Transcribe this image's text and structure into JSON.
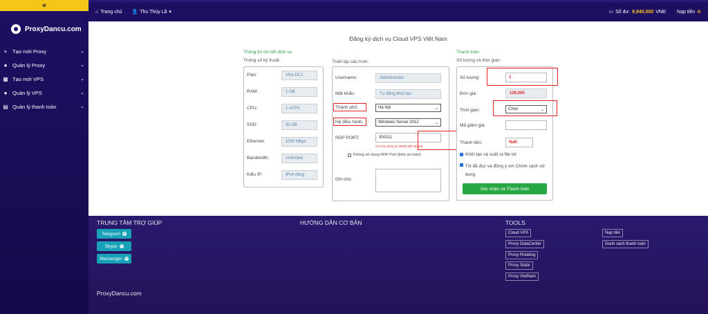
{
  "sidebar": {
    "collapse_icon": "«",
    "brand": "ProxyDancu.com",
    "items": [
      {
        "label": "Tạo mới Proxy",
        "icon": "+"
      },
      {
        "label": "Quản lý Proxy",
        "icon": "●"
      },
      {
        "label": "Tạo mới VPS",
        "icon": "▦"
      },
      {
        "label": "Quản lý VPS",
        "icon": "●"
      },
      {
        "label": "Quản lý thanh toán",
        "icon": "▤"
      }
    ]
  },
  "topbar": {
    "home": "Trang chủ",
    "user": "Thu Thủy Lã",
    "balance_label": "Số dư:",
    "balance_amount": "9,940,000",
    "balance_currency": "VNĐ",
    "topup": "Nạp tiền"
  },
  "page": {
    "title": "Đăng ký dịch vụ Cloud VPS Việt Nam"
  },
  "service": {
    "section_title": "Thông tin chi tiết dịch vụ",
    "sub": "Thông số kỹ thuật:",
    "rows": [
      {
        "label": "Plan:",
        "value": "VN1-DC1"
      },
      {
        "label": "RAM:",
        "value": "1 GB"
      },
      {
        "label": "CPU:",
        "value": "1 vCPU"
      },
      {
        "label": "SSD:",
        "value": "30 GB"
      },
      {
        "label": "Ethernet:",
        "value": "1000 Mbps"
      },
      {
        "label": "Bandwidth:",
        "value": "Unlimited"
      },
      {
        "label": "Kiểu IP:",
        "value": "IPv4 riêng"
      }
    ]
  },
  "config": {
    "sub": "Thiết lập cấu hình:",
    "username_label": "Username:",
    "username_value": "Administrator",
    "password_label": "Mật khẩu:",
    "password_value": "Tự động khởi tạo",
    "city_label": "Thành phố:",
    "city_value": "Hà Nội",
    "os_label": "Hệ điều hành:",
    "os_value": "Windows Server 2012",
    "rdp_label": "RDP PORT:",
    "rdp_value": "300111",
    "rdp_hint": "Chỉ cho phép từ 30000 đến 65535",
    "rdp_checkbox": "Không sử dụng RDP Port (kém an toàn)",
    "note_label": "Ghi chú:"
  },
  "payment": {
    "section_title": "Thanh toán",
    "sub": "Số lượng và thời gian:",
    "qty_label": "Số lượng:",
    "qty_value": "1",
    "price_label": "Đơn giá:",
    "price_value": "129,000",
    "time_label": "Thời gian:",
    "time_value": "Chọn",
    "discount_label": "Mã giảm giá:",
    "total_label": "Thành tiền:",
    "total_value": "NaN",
    "check1": "Khởi tạo và xuất ra file txt",
    "check2": "Tôi đã đọc và đồng ý với Chính sách sử dụng",
    "submit": "Xác nhận và Thanh toán"
  },
  "footer": {
    "help_title": "TRUNG TÂM TRỢ GIÚP",
    "guide_title": "HƯỚNG DẪN CƠ BẢN",
    "tools_title": "TOOLS",
    "help_buttons": [
      "Telegram",
      "Skype",
      "Messenger"
    ],
    "tools_left": [
      "Cloud VPS",
      "Proxy DataCenter",
      "Proxy Rotating",
      "Proxy Static",
      "Proxy VietNam"
    ],
    "tools_right": [
      "Nạp tiền",
      "Danh sách thanh toán"
    ],
    "brand": "ProxyDancu.com"
  }
}
